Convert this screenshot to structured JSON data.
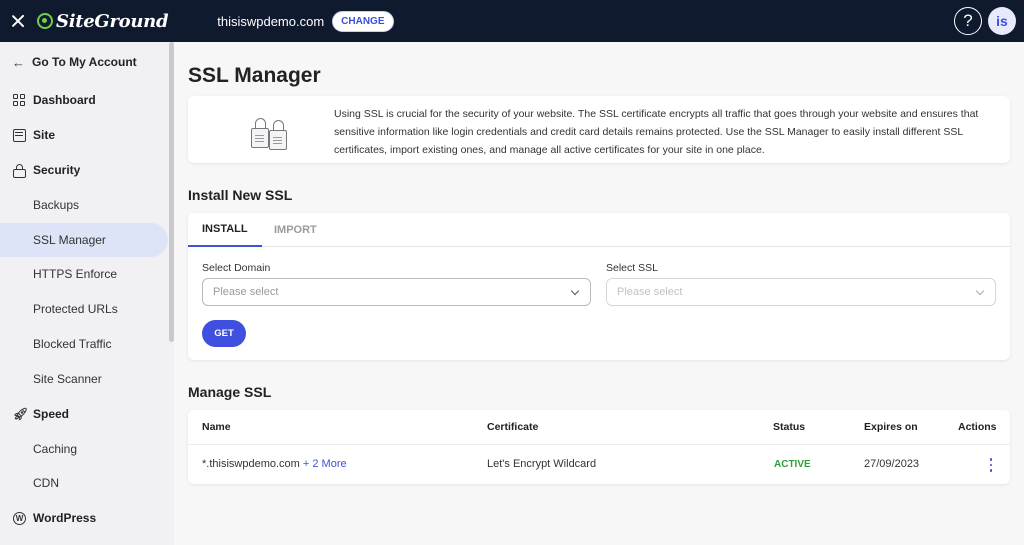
{
  "topbar": {
    "logo_text": "SiteGround",
    "site_name": "thisiswpdemo.com",
    "change_label": "CHANGE",
    "help_label": "?",
    "avatar_initials": "is"
  },
  "sidebar": {
    "back_label": "Go To My Account",
    "items": [
      {
        "label": "Dashboard",
        "type": "group",
        "icon": "dashboard-grid-icon"
      },
      {
        "label": "Site",
        "type": "group",
        "icon": "site-icon"
      },
      {
        "label": "Security",
        "type": "group",
        "icon": "lock-icon"
      },
      {
        "label": "Backups",
        "type": "sub"
      },
      {
        "label": "SSL Manager",
        "type": "sub",
        "active": true
      },
      {
        "label": "HTTPS Enforce",
        "type": "sub"
      },
      {
        "label": "Protected URLs",
        "type": "sub"
      },
      {
        "label": "Blocked Traffic",
        "type": "sub"
      },
      {
        "label": "Site Scanner",
        "type": "sub"
      },
      {
        "label": "Speed",
        "type": "group",
        "icon": "rocket-icon"
      },
      {
        "label": "Caching",
        "type": "sub"
      },
      {
        "label": "CDN",
        "type": "sub"
      },
      {
        "label": "WordPress",
        "type": "group",
        "icon": "wordpress-icon"
      }
    ]
  },
  "main": {
    "page_title": "SSL Manager",
    "info_text": "Using SSL is crucial for the security of your website. The SSL certificate encrypts all traffic that goes through your website and ensures that sensitive information like login credentials and credit card details remains protected. Use the SSL Manager to easily install different SSL certificates, import existing ones, and manage all active certificates for your site in one place.",
    "install": {
      "title": "Install New SSL",
      "tabs": [
        {
          "label": "INSTALL",
          "active": true
        },
        {
          "label": "IMPORT",
          "active": false
        }
      ],
      "domain_label": "Select Domain",
      "domain_placeholder": "Please select",
      "ssl_label": "Select SSL",
      "ssl_placeholder": "Please select",
      "get_label": "GET"
    },
    "manage": {
      "title": "Manage SSL",
      "columns": {
        "name": "Name",
        "certificate": "Certificate",
        "status": "Status",
        "expires": "Expires on",
        "actions": "Actions"
      },
      "rows": [
        {
          "name": "*.thisiswpdemo.com",
          "more": "+ 2 More",
          "certificate": "Let's Encrypt Wildcard",
          "status": "ACTIVE",
          "expires": "27/09/2023"
        }
      ]
    }
  },
  "colors": {
    "accent": "#3f4fe0",
    "topbar": "#0f1a2e",
    "status_active": "#2e9e3e",
    "logo_green": "#6fcf4d"
  }
}
